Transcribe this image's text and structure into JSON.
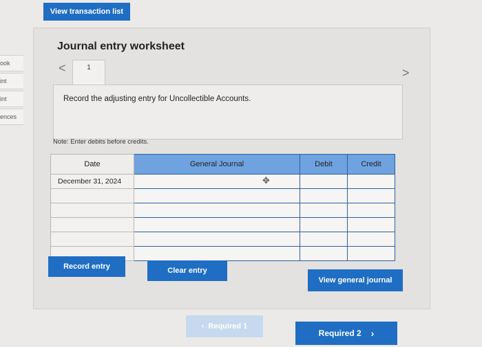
{
  "header": {
    "view_transactions_label": "View transaction list"
  },
  "sidebar": {
    "items": [
      "ook",
      "int",
      "int",
      "ences"
    ]
  },
  "worksheet": {
    "title": "Journal entry worksheet",
    "prev_arrow": "<",
    "next_arrow": ">",
    "tab_number": "1",
    "instruction": "Record the adjusting entry for Uncollectible Accounts.",
    "note": "Note: Enter debits before credits."
  },
  "table": {
    "headers": {
      "date": "Date",
      "journal": "General Journal",
      "debit": "Debit",
      "credit": "Credit"
    },
    "rows": [
      {
        "date": "December 31, 2024"
      },
      {
        "date": ""
      },
      {
        "date": ""
      },
      {
        "date": ""
      },
      {
        "date": ""
      },
      {
        "date": ""
      }
    ]
  },
  "buttons": {
    "record_entry": "Record entry",
    "clear_entry": "Clear entry",
    "view_general_journal": "View general journal"
  },
  "footer": {
    "required1": "Required 1",
    "required2": "Required 2"
  },
  "colors": {
    "primary_blue": "#1f6ec4",
    "header_blue": "#6fa3e0"
  }
}
